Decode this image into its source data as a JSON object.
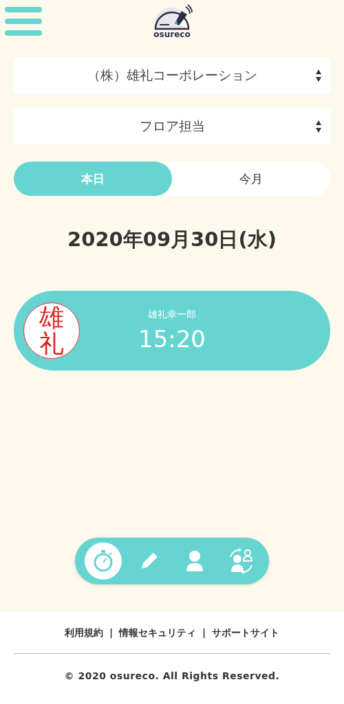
{
  "header": {
    "logo_text": "osureco"
  },
  "selects": [
    {
      "value": "（株）雄礼コーポレーション"
    },
    {
      "value": "フロア担当"
    }
  ],
  "tabs": [
    {
      "label": "本日",
      "selected": true
    },
    {
      "label": "今月",
      "selected": false
    }
  ],
  "date": "2020年09月30日(水)",
  "records": [
    {
      "seal": "雄礼",
      "name": "雄礼幸一郎",
      "time": "15:20"
    }
  ],
  "bottom_nav": [
    {
      "kind": "stopwatch",
      "selected": true
    },
    {
      "kind": "pencil",
      "selected": false
    },
    {
      "kind": "person",
      "selected": false
    },
    {
      "kind": "switch-user",
      "selected": false
    }
  ],
  "footer": {
    "links": [
      "利用規約",
      "情報セキュリティ",
      "サポートサイト"
    ],
    "separator": "|",
    "copyright": "© 2020 osureco. All Rights Reserved."
  }
}
